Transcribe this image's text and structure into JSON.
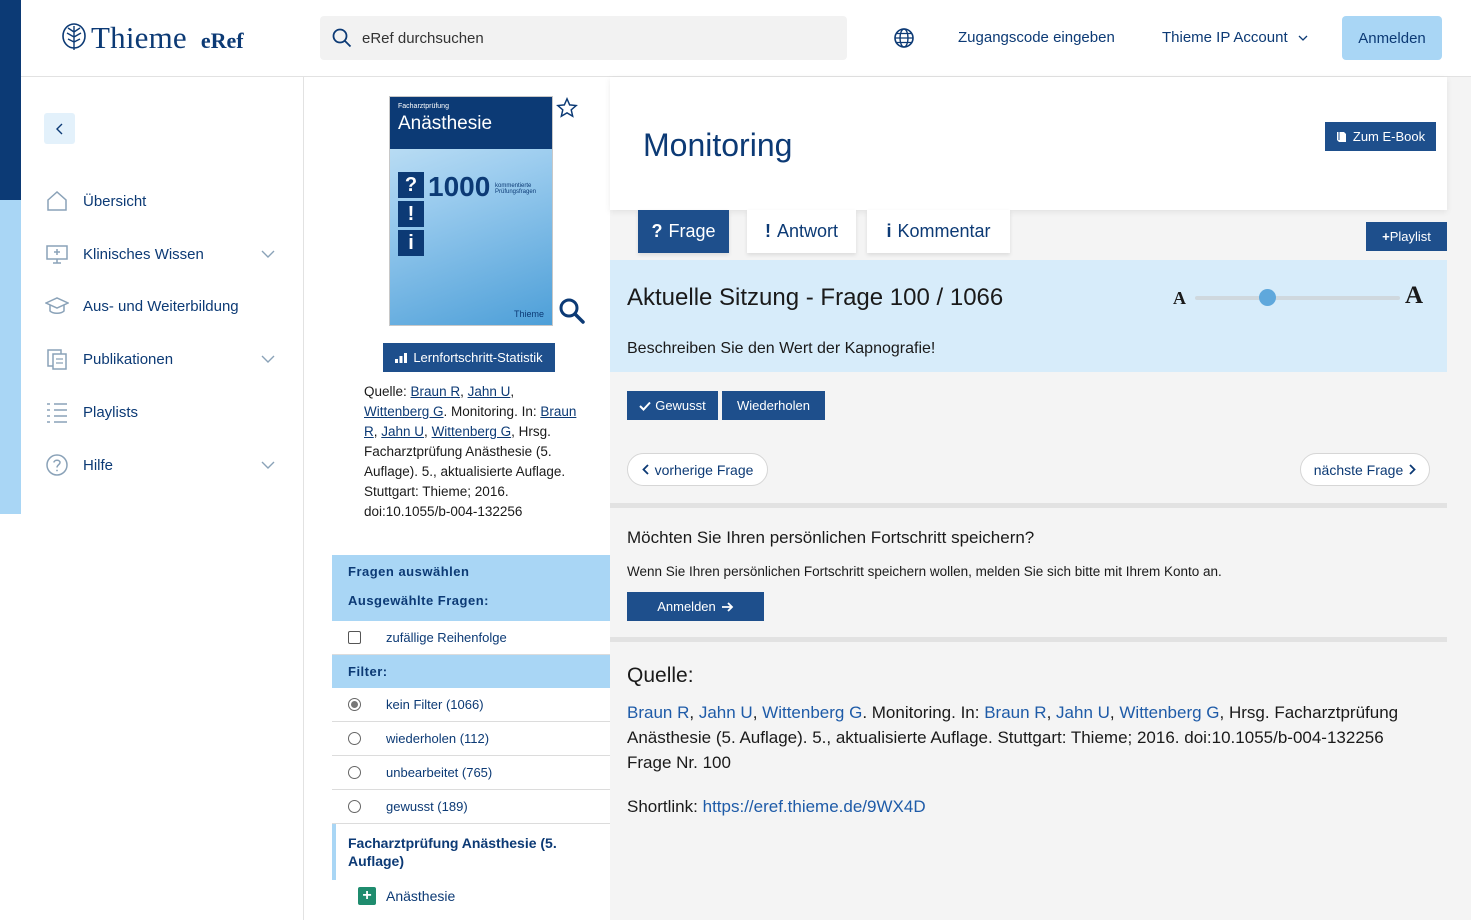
{
  "header": {
    "logo_word": "Thieme",
    "logo_product": "eRef",
    "search_placeholder": "eRef durchsuchen",
    "access_code": "Zugangscode eingeben",
    "account": "Thieme IP Account",
    "login": "Anmelden"
  },
  "sidebar": {
    "items": [
      {
        "label": "Übersicht",
        "icon": "home-icon"
      },
      {
        "label": "Klinisches Wissen",
        "icon": "monitor-icon"
      },
      {
        "label": "Aus- und Weiterbildung",
        "icon": "graduation-cap-icon"
      },
      {
        "label": "Publikationen",
        "icon": "documents-icon"
      },
      {
        "label": "Playlists",
        "icon": "list-icon"
      },
      {
        "label": "Hilfe",
        "icon": "help-icon"
      }
    ]
  },
  "book": {
    "cover_subtitle": "Facharztprüfung",
    "cover_title": "Anästhesie",
    "cover_number": "1000",
    "cover_tagline": "kommentierte Prüfungsfragen",
    "cover_brand": "Thieme",
    "stats_button": "Lernfortschritt-Statistik",
    "source_label": "Quelle:",
    "authors": [
      "Braun R",
      "Jahn U",
      "Wittenberg G"
    ],
    "source_mid": ". Monitoring. In:",
    "source_rest": ", Hrsg. Facharztprüfung Anästhesie (5. Auflage). 5., aktualisierte Auflage. Stuttgart: Thieme; 2016. doi:10.1055/b-004-132256"
  },
  "filters": {
    "select_header": "Fragen auswählen",
    "selected_header": "Ausgewählte Fragen:",
    "random_order": "zufällige Reihenfolge",
    "filter_header": "Filter:",
    "options": [
      {
        "label": "kein Filter (1066)",
        "selected": true
      },
      {
        "label": "wiederholen (112)",
        "selected": false
      },
      {
        "label": "unbearbeitet (765)",
        "selected": false
      },
      {
        "label": "gewusst (189)",
        "selected": false
      }
    ],
    "section_title": "Facharztprüfung Anästhesie (5. Auflage)",
    "tree_item": "Anästhesie"
  },
  "main": {
    "title": "Monitoring",
    "ebook_button": "Zum E-Book",
    "tabs": [
      {
        "glyph": "?",
        "label": "Frage",
        "active": true
      },
      {
        "glyph": "!",
        "label": "Antwort",
        "active": false
      },
      {
        "glyph": "i",
        "label": "Kommentar",
        "active": false
      }
    ],
    "playlist_button": "Playlist",
    "session_title": "Aktuelle Sitzung - Frage 100 / 1066",
    "question": "Beschreiben Sie den Wert der Kapnografie!",
    "font_small": "A",
    "font_big": "A",
    "font_size_level": 0.35,
    "known_button": "Gewusst",
    "repeat_button": "Wiederholen",
    "prev_button": "vorherige Frage",
    "next_button": "nächste Frage",
    "progress_title": "Möchten Sie Ihren persönlichen Fortschritt speichern?",
    "progress_text": "Wenn Sie Ihren persönlichen Fortschritt speichern wollen, melden Sie sich bitte mit Ihrem Konto an.",
    "progress_login": "Anmelden",
    "source_head": "Quelle:",
    "source_rest": ", Hrsg. Facharztprüfung Anästhesie (5. Auflage). 5., aktualisierte Auflage. Stuttgart: Thieme; 2016. doi:10.1055/b-004-132256",
    "question_number": "Frage Nr. 100",
    "shortlink_label": "Shortlink:",
    "shortlink_url": "https://eref.thieme.de/9WX4D"
  },
  "colors": {
    "brand_navy": "#0c3a75",
    "button_blue": "#1e4f8c",
    "light_blue": "#a9d6f5",
    "session_bg": "#d7ecfa",
    "link_blue": "#1e5ba8"
  }
}
